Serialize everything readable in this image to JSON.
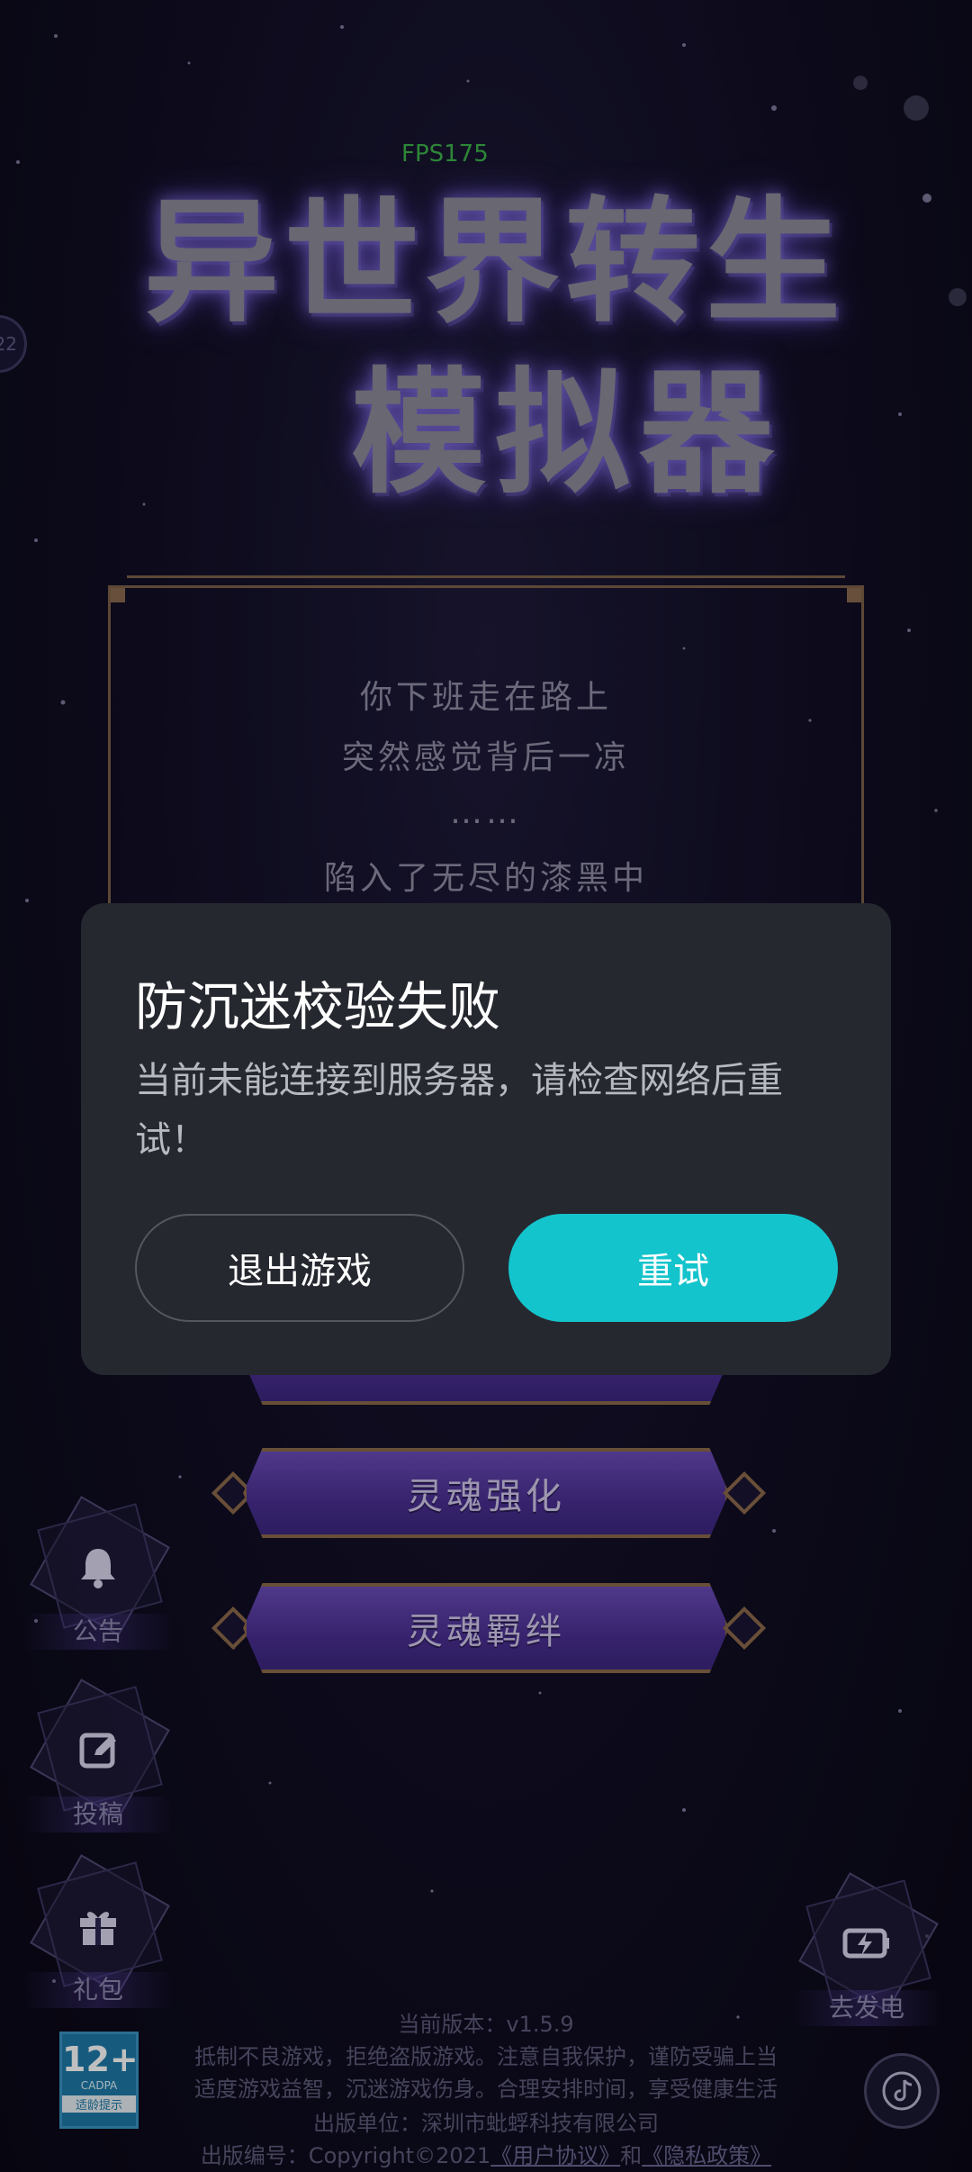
{
  "hud": {
    "fps": "FPS175",
    "left_badge": "22"
  },
  "title": {
    "line1": "异世界转生",
    "line2": "模拟器"
  },
  "story": {
    "lines": [
      "你下班走在路上",
      "突然感觉背后一凉",
      "……",
      "陷入了无尽的漆黑中"
    ]
  },
  "menu": {
    "buttons": [
      {
        "label": ""
      },
      {
        "label": "灵魂强化"
      },
      {
        "label": "灵魂羁绊"
      }
    ]
  },
  "side_left": {
    "notice": "公告",
    "submit": "投稿",
    "gift": "礼包"
  },
  "side_right": {
    "charge": "去发电"
  },
  "footer": {
    "version": "当前版本：v1.5.9",
    "notice_line1": "抵制不良游戏，拒绝盗版游戏。注意自我保护，谨防受骗上当",
    "notice_line2": "适度游戏益智，沉迷游戏伤身。合理安排时间，享受健康生活",
    "publisher": "出版单位：深圳市蚍蜉科技有限公司",
    "copyright_prefix": "出版编号：Copyright©2021",
    "user_agreement": "《用户协议》",
    "and": "和",
    "privacy_policy": "《隐私政策》"
  },
  "age_rating": {
    "number": "12+",
    "org": "CADPA",
    "tag": "适龄提示"
  },
  "dialog": {
    "title": "防沉迷校验失败",
    "message": "当前未能连接到服务器，请检查网络后重试！",
    "exit_label": "退出游戏",
    "retry_label": "重试"
  },
  "colors": {
    "dialog_bg": "#262830",
    "retry_accent": "#14c4cc",
    "menu_purple": "#4a2f92",
    "gold_border": "#8b6a4a"
  }
}
